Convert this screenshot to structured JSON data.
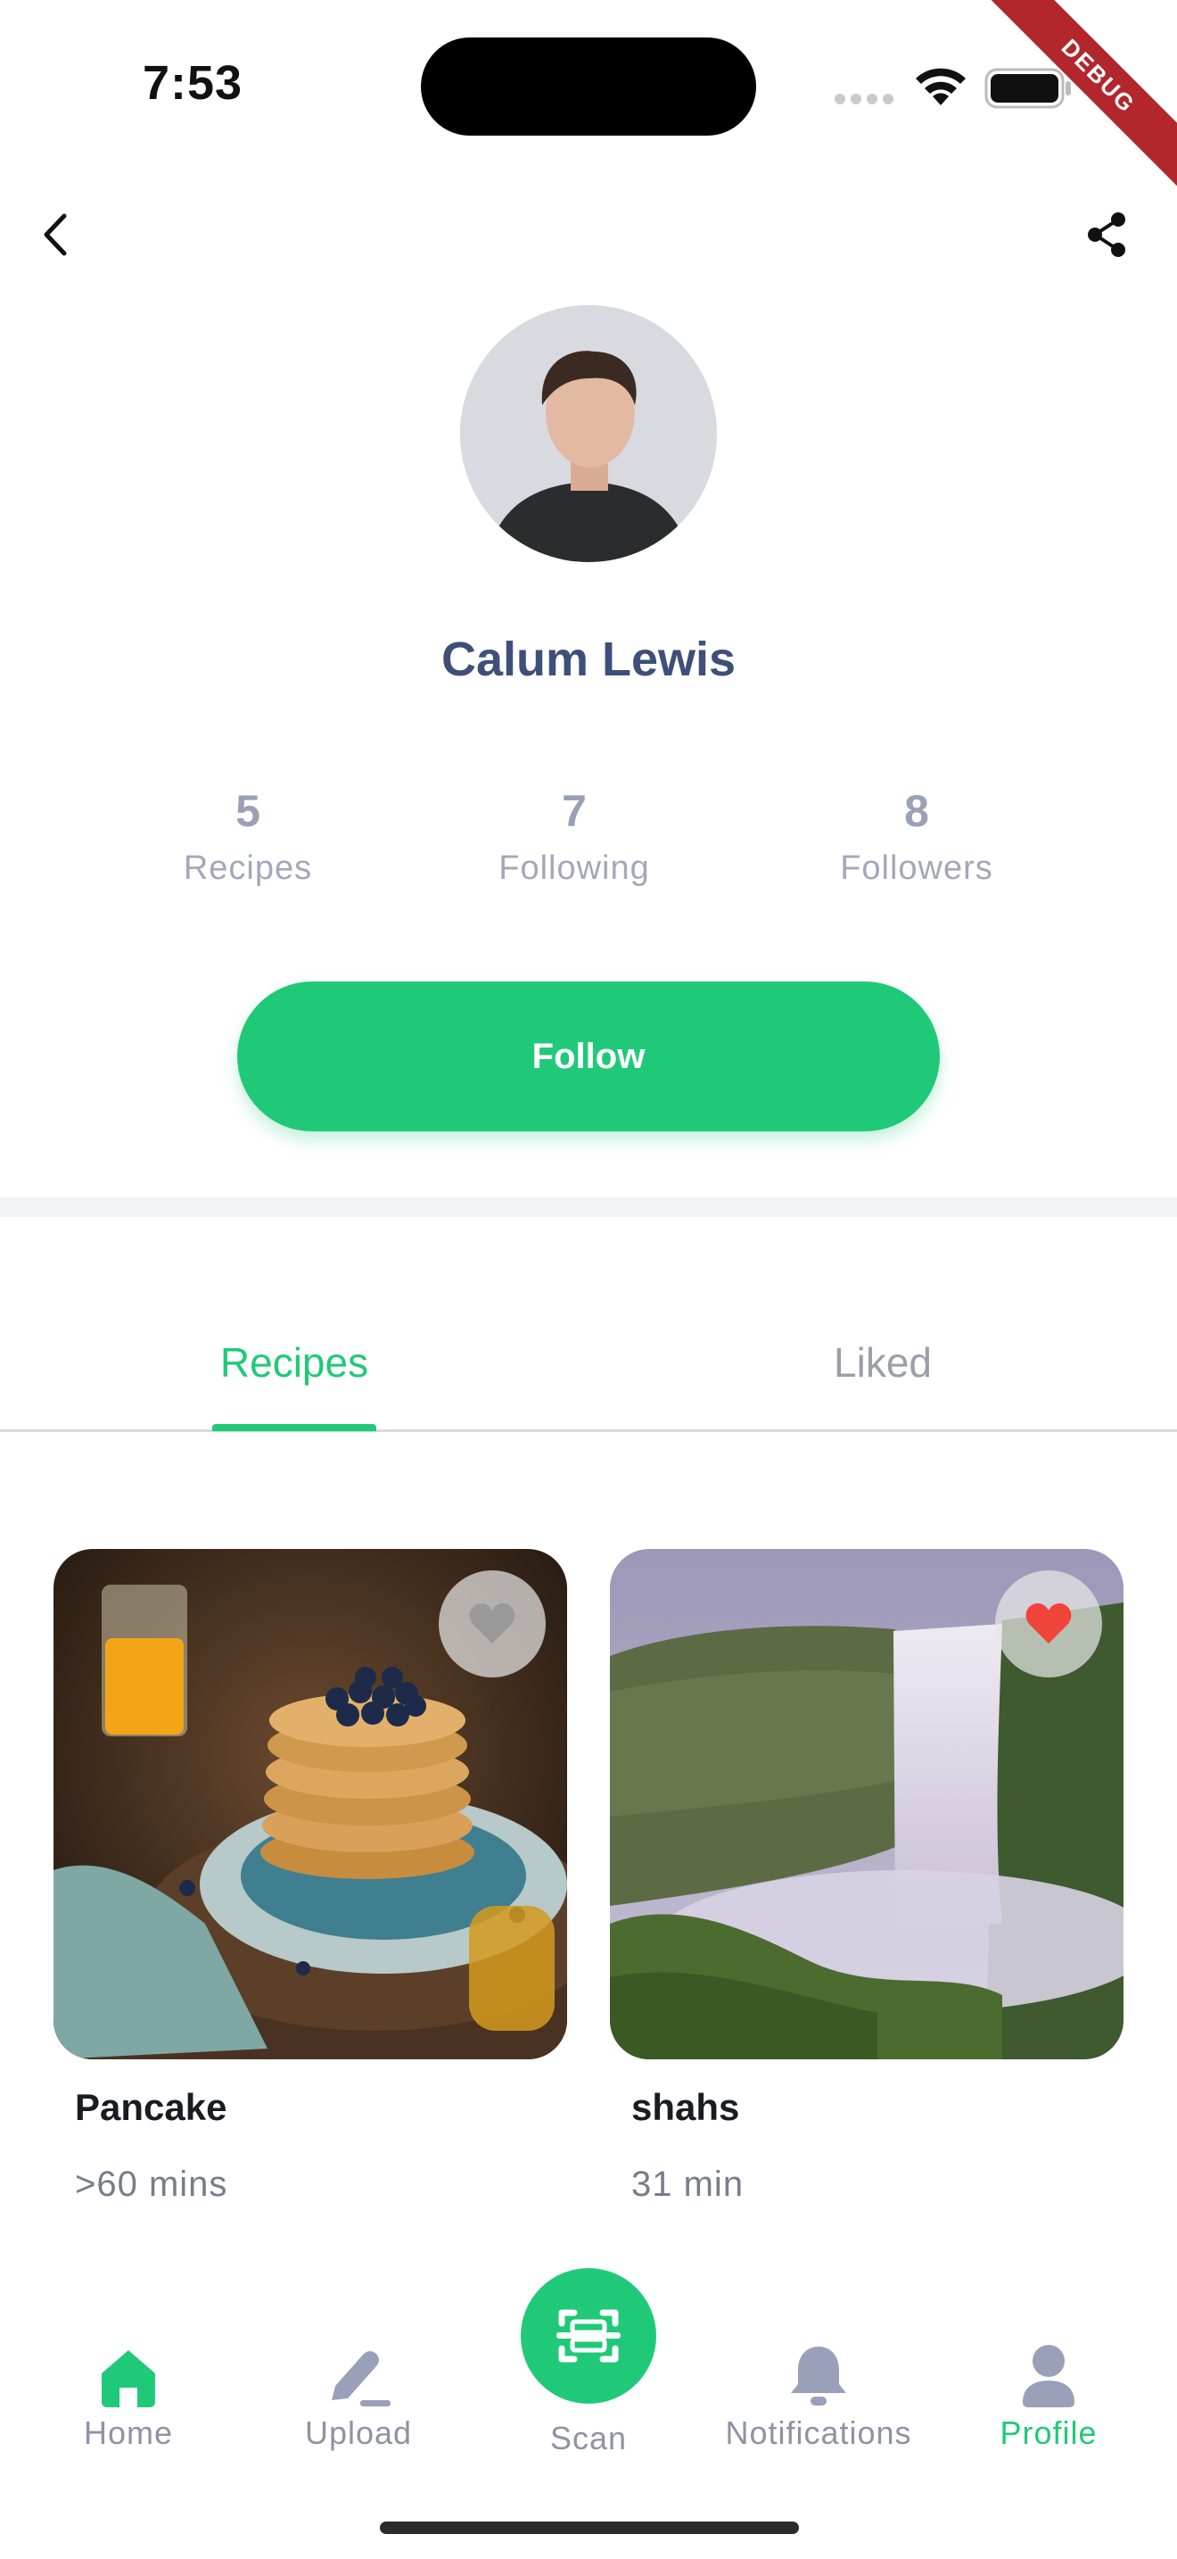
{
  "status_bar": {
    "time": "7:53"
  },
  "debug_banner": "DEBUG",
  "profile": {
    "name": "Calum Lewis",
    "stats": [
      {
        "value": "5",
        "label": "Recipes"
      },
      {
        "value": "7",
        "label": "Following"
      },
      {
        "value": "8",
        "label": "Followers"
      }
    ],
    "follow_label": "Follow"
  },
  "tabs": [
    {
      "label": "Recipes",
      "active": true
    },
    {
      "label": "Liked",
      "active": false
    }
  ],
  "recipes": [
    {
      "title": "Pancake",
      "time": ">60 mins",
      "liked": false
    },
    {
      "title": "shahs",
      "time": "31 min",
      "liked": true
    }
  ],
  "bottom_nav": [
    {
      "label": "Home",
      "icon": "home-icon"
    },
    {
      "label": "Upload",
      "icon": "pencil-icon"
    },
    {
      "label": "Scan",
      "icon": "scan-icon"
    },
    {
      "label": "Notifications",
      "icon": "bell-icon"
    },
    {
      "label": "Profile",
      "icon": "user-icon",
      "active": true
    }
  ],
  "colors": {
    "accent": "#20c978",
    "name": "#3e4f7a",
    "muted": "#9aa1b6",
    "like": "#f0433a"
  }
}
